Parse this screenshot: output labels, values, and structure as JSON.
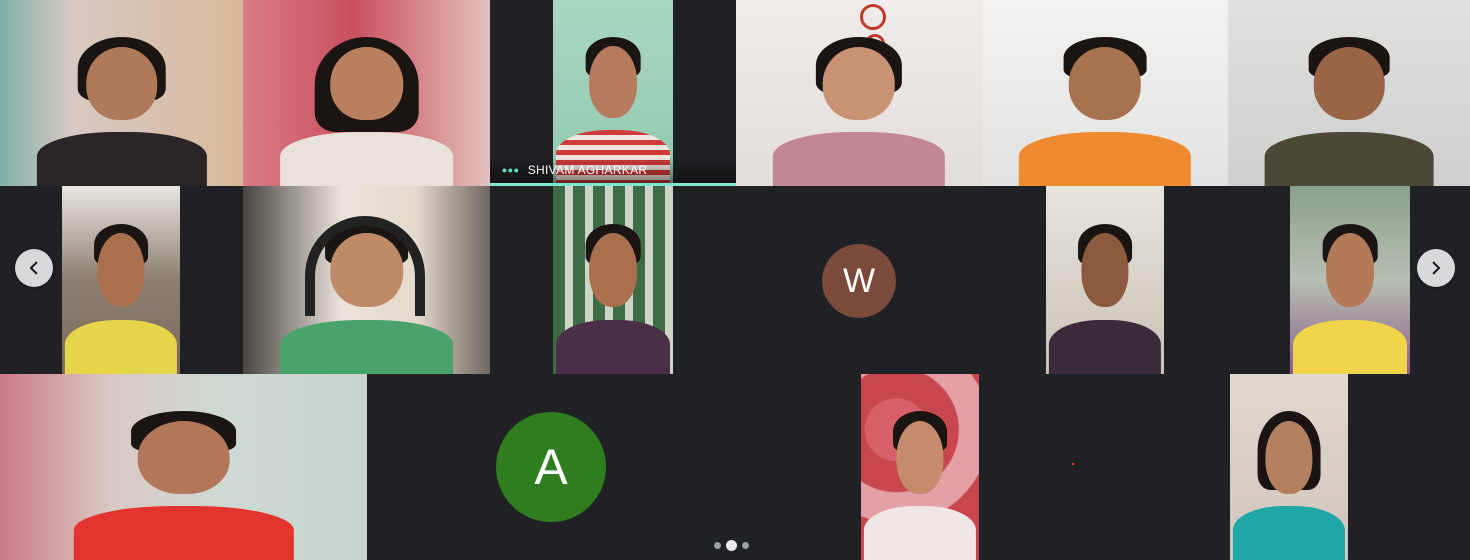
{
  "meeting": {
    "tiles": [
      {
        "id": "p1",
        "kind": "video",
        "bg": "#d7c9c2",
        "skin": "#b07a5a",
        "shirt": "#2a2527"
      },
      {
        "id": "p2",
        "kind": "video",
        "bg": "#d97b86",
        "skin": "#b98060",
        "shirt": "#e8e2da"
      },
      {
        "id": "p3",
        "kind": "video",
        "bg": "#a8d7c0",
        "skin": "#b67b5d",
        "shirt": "#cf3a3a",
        "name": "SHIVAM AGHARKAR",
        "speaking": true
      },
      {
        "id": "p4",
        "kind": "video",
        "bg": "#e9e4e2",
        "skin": "#c99274",
        "shirt": "#c48692"
      },
      {
        "id": "p5",
        "kind": "video",
        "bg": "#ececea",
        "skin": "#a8714f",
        "shirt": "#ef8a30"
      },
      {
        "id": "p6",
        "kind": "video",
        "bg": "#d8d8d6",
        "skin": "#9a6446",
        "shirt": "#4b4936"
      },
      {
        "id": "p7",
        "kind": "video",
        "bg": "#c9c2b8",
        "skin": "#a8704f",
        "shirt": "#e6d44a"
      },
      {
        "id": "p8",
        "kind": "video",
        "bg": "#eae4dc",
        "skin": "#c08a68",
        "shirt": "#4aa36b"
      },
      {
        "id": "p9",
        "kind": "video",
        "bg": "#4f7a4f",
        "skin": "#a8704f",
        "shirt": "#4b2f47"
      },
      {
        "id": "p10",
        "kind": "avatar",
        "letter": "W",
        "color": "#7a4a3a"
      },
      {
        "id": "p11",
        "kind": "video",
        "bg": "#d9d2c8",
        "skin": "#8c5a3c",
        "shirt": "#3a2a3a"
      },
      {
        "id": "p12",
        "kind": "video",
        "bg": "#b6bfb2",
        "skin": "#b47a58",
        "shirt": "#f0d44a"
      },
      {
        "id": "p13",
        "kind": "video",
        "bg": "#cfd9d4",
        "skin": "#b2775a",
        "shirt": "#e3342d"
      },
      {
        "id": "p14",
        "kind": "avatar",
        "letter": "A",
        "color": "#2e7d1f"
      },
      {
        "id": "p15",
        "kind": "video",
        "bg": "#c8464e",
        "skin": "#c48c6c",
        "shirt": "#f1e6e6"
      },
      {
        "id": "p16",
        "kind": "video",
        "bg": "#e1d8cf",
        "skin": "#b58060",
        "shirt": "#1fa6a6"
      }
    ],
    "nav": {
      "prev_icon": "chevron-left-icon",
      "next_icon": "chevron-right-icon"
    },
    "pagination": {
      "pages": 3,
      "current": 2
    }
  }
}
